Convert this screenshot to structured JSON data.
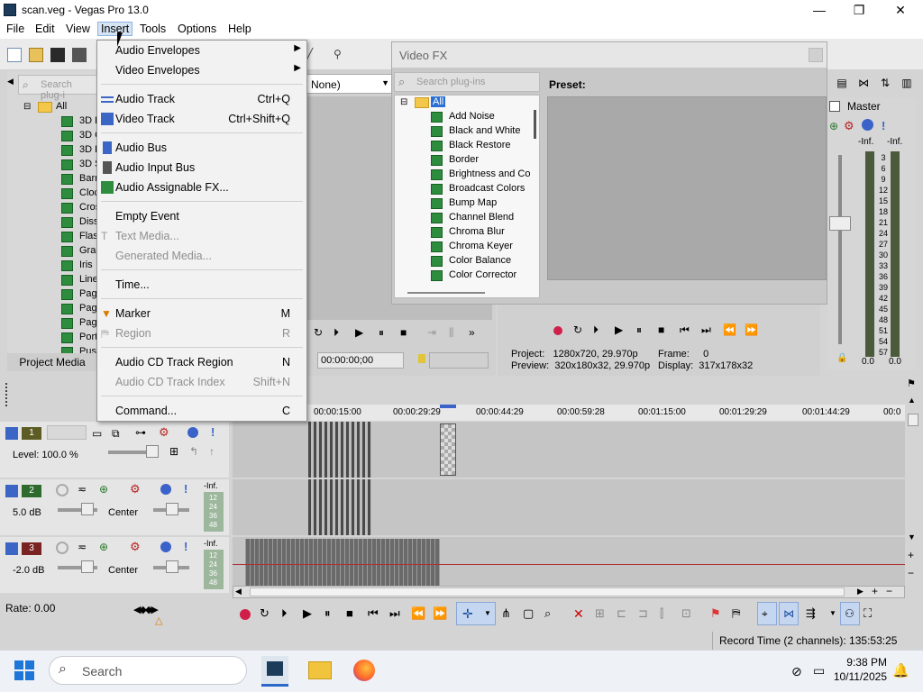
{
  "window": {
    "title": "scan.veg - Vegas Pro 13.0",
    "minimize": "—",
    "maximize": "❐",
    "close": "✕"
  },
  "menubar": [
    "File",
    "Edit",
    "View",
    "Insert",
    "Tools",
    "Options",
    "Help"
  ],
  "insert_menu": {
    "items": [
      {
        "label": "Audio Envelopes",
        "shortcut": "",
        "submenu": true,
        "disabled": false
      },
      {
        "label": "Video Envelopes",
        "shortcut": "",
        "submenu": true,
        "disabled": false
      },
      {
        "label": "Audio Track",
        "shortcut": "Ctrl+Q",
        "disabled": false
      },
      {
        "label": "Video Track",
        "shortcut": "Ctrl+Shift+Q",
        "disabled": false
      },
      {
        "label": "Audio Bus",
        "shortcut": "",
        "disabled": false
      },
      {
        "label": "Audio Input Bus",
        "shortcut": "",
        "disabled": false
      },
      {
        "label": "Audio Assignable FX...",
        "shortcut": "",
        "disabled": false
      },
      {
        "label": "Empty Event",
        "shortcut": "",
        "disabled": false
      },
      {
        "label": "Text Media...",
        "shortcut": "",
        "disabled": true
      },
      {
        "label": "Generated Media...",
        "shortcut": "",
        "disabled": true
      },
      {
        "label": "Time...",
        "shortcut": "",
        "disabled": false
      },
      {
        "label": "Marker",
        "shortcut": "M",
        "disabled": false
      },
      {
        "label": "Region",
        "shortcut": "R",
        "disabled": true
      },
      {
        "label": "Audio CD Track Region",
        "shortcut": "N",
        "disabled": false
      },
      {
        "label": "Audio CD Track Index",
        "shortcut": "Shift+N",
        "disabled": true
      },
      {
        "label": "Command...",
        "shortcut": "C",
        "disabled": false
      }
    ]
  },
  "media_panel": {
    "search_placeholder": "Search plug-i",
    "root": "All",
    "items": [
      "3D Bl",
      "3D C",
      "3D Fl",
      "3D Sl",
      "Barn",
      "Clock",
      "Cross",
      "Disso",
      "Flash",
      "Grad",
      "Iris",
      "Linea",
      "Page",
      "Page",
      "Page",
      "Portal",
      "Push"
    ],
    "tab": "Project Media"
  },
  "preview_dropdown": "None)",
  "video_fx": {
    "title": "Video FX",
    "search_placeholder": "Search plug-ins",
    "root": "All",
    "plugins": [
      "Add Noise",
      "Black and White",
      "Black Restore",
      "Border",
      "Brightness and Co",
      "Broadcast Colors",
      "Bump Map",
      "Channel Blend",
      "Chroma Blur",
      "Chroma Keyer",
      "Color Balance",
      "Color Corrector"
    ],
    "preset_label": "Preset:"
  },
  "trimmer": {
    "timecode": "00:00:00;00"
  },
  "preview_info": {
    "project_label": "Project:",
    "project_value": "1280x720, 29.970p",
    "frame_label": "Frame:",
    "frame_value": "0",
    "preview_label": "Preview:",
    "preview_value": "320x180x32, 29.970p",
    "display_label": "Display:",
    "display_value": "317x178x32"
  },
  "master": {
    "label": "Master",
    "inf_left": "-Inf.",
    "inf_right": "-Inf.",
    "scale": [
      "3",
      "6",
      "9",
      "12",
      "15",
      "18",
      "21",
      "24",
      "27",
      "30",
      "33",
      "36",
      "39",
      "42",
      "45",
      "48",
      "51",
      "54",
      "57"
    ],
    "bottom_left": "0.0",
    "bottom_right": "0.0"
  },
  "ruler_ticks": [
    "00:00:15:00",
    "00:00:29:29",
    "00:00:44:29",
    "00:00:59:28",
    "00:01:15:00",
    "00:01:29:29",
    "00:01:44:29",
    "00:0"
  ],
  "tracks": [
    {
      "num": "1",
      "label": "Level: 100.0 %",
      "pan": "",
      "color": "#5c5c24"
    },
    {
      "num": "2",
      "label": "5.0 dB",
      "pan": "Center",
      "color": "#2f6a2f",
      "inf": "-Inf.",
      "meter": [
        "12",
        "24",
        "36",
        "48"
      ]
    },
    {
      "num": "3",
      "label": "-2.0 dB",
      "pan": "Center",
      "color": "#7a2323",
      "inf": "-Inf.",
      "meter": [
        "12",
        "24",
        "36",
        "48"
      ]
    }
  ],
  "rate": "Rate: 0.00",
  "status": "Record Time (2 channels): 135:53:25",
  "taskbar": {
    "search": "Search",
    "time": "9:38 PM",
    "date": "10/11/2025"
  }
}
